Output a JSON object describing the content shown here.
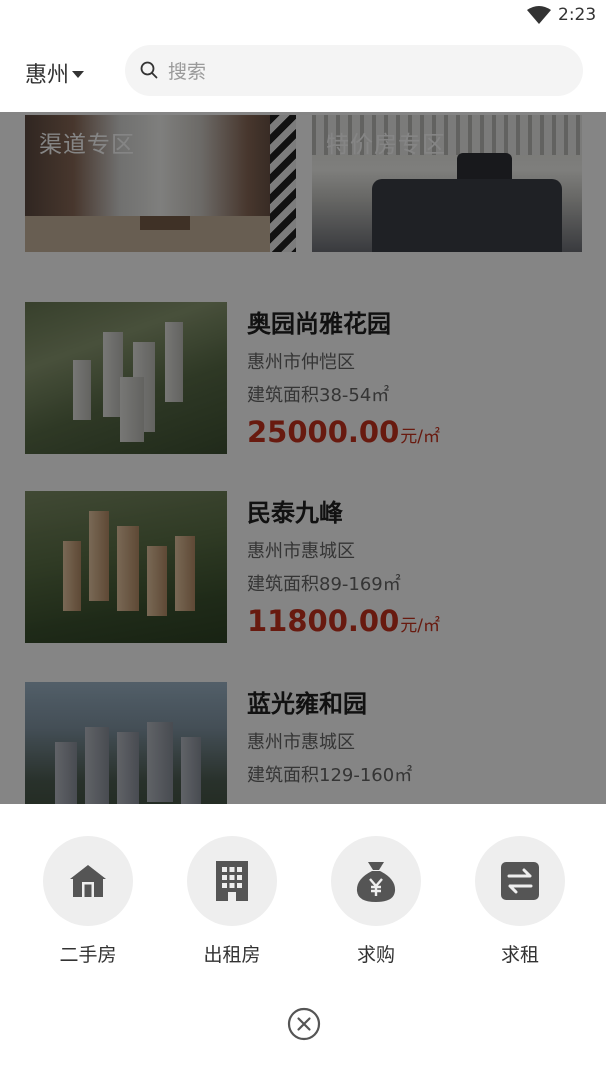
{
  "status": {
    "time": "2:23"
  },
  "header": {
    "city": "惠州",
    "search_placeholder": "搜索"
  },
  "banners": [
    {
      "title": "渠道专区"
    },
    {
      "title": "特价房专区"
    }
  ],
  "listings": [
    {
      "name": "奥园尚雅花园",
      "district": "惠州市仲恺区",
      "area": "建筑面积38-54㎡",
      "price": "25000.00",
      "unit": "元/㎡"
    },
    {
      "name": "民泰九峰",
      "district": "惠州市惠城区",
      "area": "建筑面积89-169㎡",
      "price": "11800.00",
      "unit": "元/㎡"
    },
    {
      "name": "蓝光雍和园",
      "district": "惠州市惠城区",
      "area": "建筑面积129-160㎡",
      "price": "",
      "unit": ""
    }
  ],
  "actions": [
    {
      "label": "二手房",
      "icon": "house-icon"
    },
    {
      "label": "出租房",
      "icon": "building-icon"
    },
    {
      "label": "求购",
      "icon": "money-bag-icon"
    },
    {
      "label": "求租",
      "icon": "swap-icon"
    }
  ],
  "colors": {
    "price": "#c8321e",
    "icon": "#555555",
    "icon_bg": "#eeeeee"
  }
}
